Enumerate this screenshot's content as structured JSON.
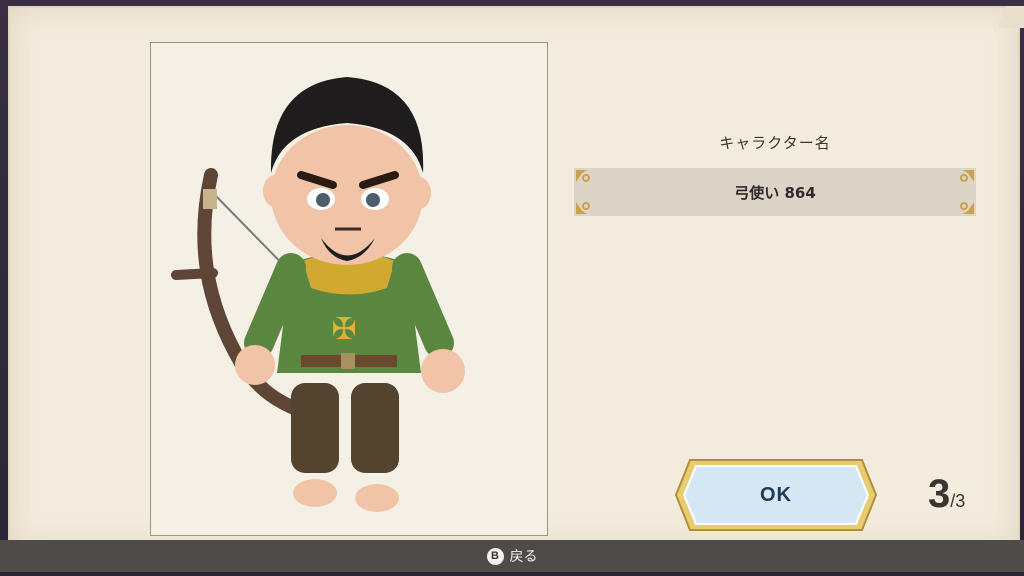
{
  "character": {
    "name_caption": "キャラクター名",
    "name_value": "弓使い 864"
  },
  "actions": {
    "ok_label": "OK"
  },
  "pagination": {
    "current": "3",
    "total": "/3"
  },
  "footer": {
    "back_button_glyph": "B",
    "back_label": "戻る"
  },
  "icons": {
    "corner_ornament": "ornate-corner-icon",
    "controller_b": "b-button-icon"
  },
  "colors": {
    "parchment": "#f3ecde",
    "name_field": "#ddd4c8",
    "ok_button_fill": "#d6e8f3",
    "ok_button_border": "#d9b651",
    "footer_bar": "#4f4b48"
  }
}
